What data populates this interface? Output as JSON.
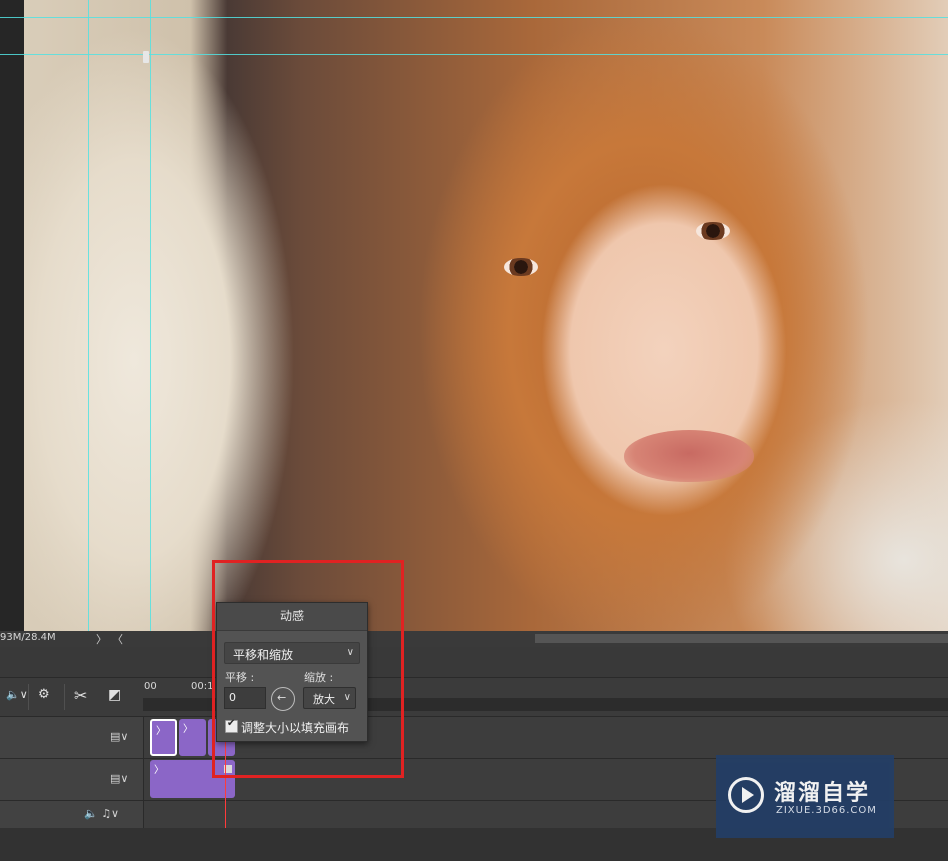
{
  "status_bar": {
    "doc_size": "93M/28.4M",
    "next_arrow": "〉",
    "prev_arrow": "〈"
  },
  "timeline": {
    "ruler_labels": [
      "00",
      "00:1"
    ],
    "track_icons": {
      "video_track_1": "▤∨",
      "video_track_2": "▤∨",
      "audio_track": "🔈 ♫∨"
    }
  },
  "toolbar": {
    "mute_icon": "🔈∨",
    "settings_icon": "⚙",
    "split_icon": "✂",
    "transition_icon": "◩"
  },
  "motion_popup": {
    "title": "动感",
    "preset_value": "平移和缩放",
    "pan_label": "平移 :",
    "zoom_label": "缩放 :",
    "pan_value": "0",
    "dial_arrow": "←",
    "zoom_value": "放大",
    "resize_checkbox_label": "调整大小以填充画布",
    "resize_checked": true
  },
  "watermark": {
    "title": "溜溜自学",
    "url": "ZIXUE.3D66.COM"
  },
  "colors": {
    "clip": "#8b66c7",
    "playhead": "#ff3b3b",
    "highlight": "#e02222",
    "guide": "#52e2e2"
  }
}
